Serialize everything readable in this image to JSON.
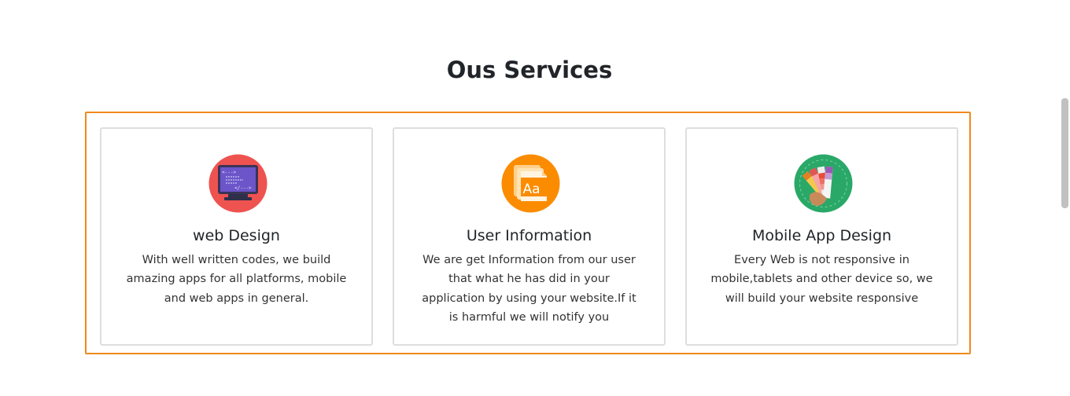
{
  "section": {
    "title": "Ous Services"
  },
  "services": [
    {
      "title": "web Design",
      "description": "With well written codes, we build amazing apps for all platforms, mobile and web apps in general.",
      "icon": "monitor-code-icon"
    },
    {
      "title": "User Information",
      "description": "We are get Information from our user that what he has did in your application by using your website.If it is harmful we will notify you",
      "icon": "font-document-icon"
    },
    {
      "title": "Mobile App Design",
      "description": "Every Web is not responsive in mobile,tablets and other device so, we will build your website responsive",
      "icon": "color-palette-icon"
    }
  ],
  "colors": {
    "accent_border": "#f0891d",
    "card_border": "#dedede",
    "icon1_bg": "#ef5350",
    "icon2_bg": "#fb8c00",
    "icon3_bg": "#2aa868"
  }
}
